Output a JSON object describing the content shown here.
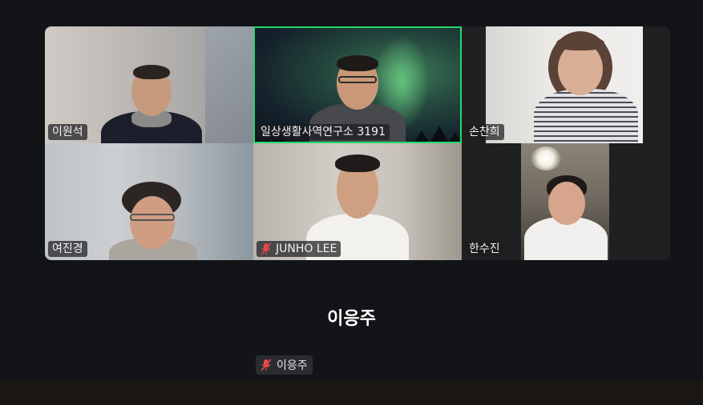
{
  "participants": [
    {
      "name": "이원석",
      "muted": false
    },
    {
      "name": "일상생활사역연구소 3191",
      "muted": false,
      "active_speaker": true
    },
    {
      "name": "손찬희",
      "muted": false
    },
    {
      "name": "여진경",
      "muted": false
    },
    {
      "name": "JUNHO LEE",
      "muted": true
    },
    {
      "name": "한수진",
      "muted": false
    }
  ],
  "self_view": {
    "name": "이응주",
    "tag_label": "이응주",
    "muted": true
  },
  "colors": {
    "background": "#121417",
    "active_border": "#23d96c",
    "muted_icon": "#e5484d"
  },
  "icons": {
    "muted": "mic-off-icon"
  }
}
